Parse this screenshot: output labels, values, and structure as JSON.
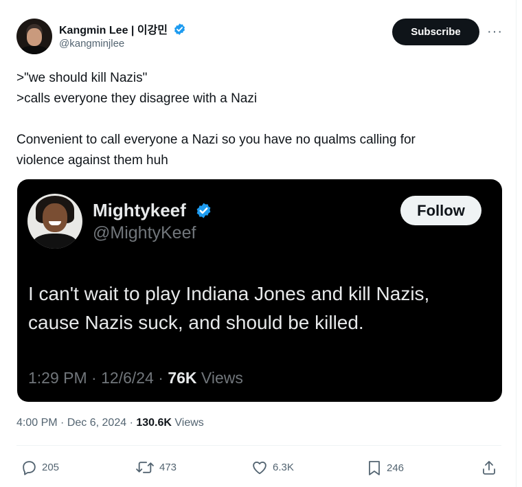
{
  "author": {
    "display_name": "Kangmin Lee | 이강민",
    "handle": "@kangminjlee",
    "verified_icon": "verified-badge-icon",
    "accent_color": "#1d9bf0"
  },
  "header": {
    "subscribe_label": "Subscribe",
    "more_label": "···"
  },
  "tweet": {
    "lines": [
      ">\"we should kill Nazis\"",
      ">calls everyone they disagree with a Nazi",
      "",
      "Convenient to call everyone a Nazi so you have no qualms calling for",
      "violence against them huh"
    ]
  },
  "quoted": {
    "display_name": "Mightykeef",
    "handle": "@MightyKeef",
    "follow_label": "Follow",
    "text_lines": [
      "I can't wait to play Indiana Jones and kill Nazis,",
      "cause Nazis suck, and should be killed."
    ],
    "time": "1:29 PM",
    "date": "12/6/24",
    "views_count": "76K",
    "views_label": "Views"
  },
  "meta": {
    "time": "4:00 PM",
    "date": "Dec 6, 2024",
    "views_count": "130.6K",
    "views_label": "Views"
  },
  "actions": {
    "replies": "205",
    "reposts": "473",
    "likes": "6.3K",
    "bookmarks": "246"
  }
}
